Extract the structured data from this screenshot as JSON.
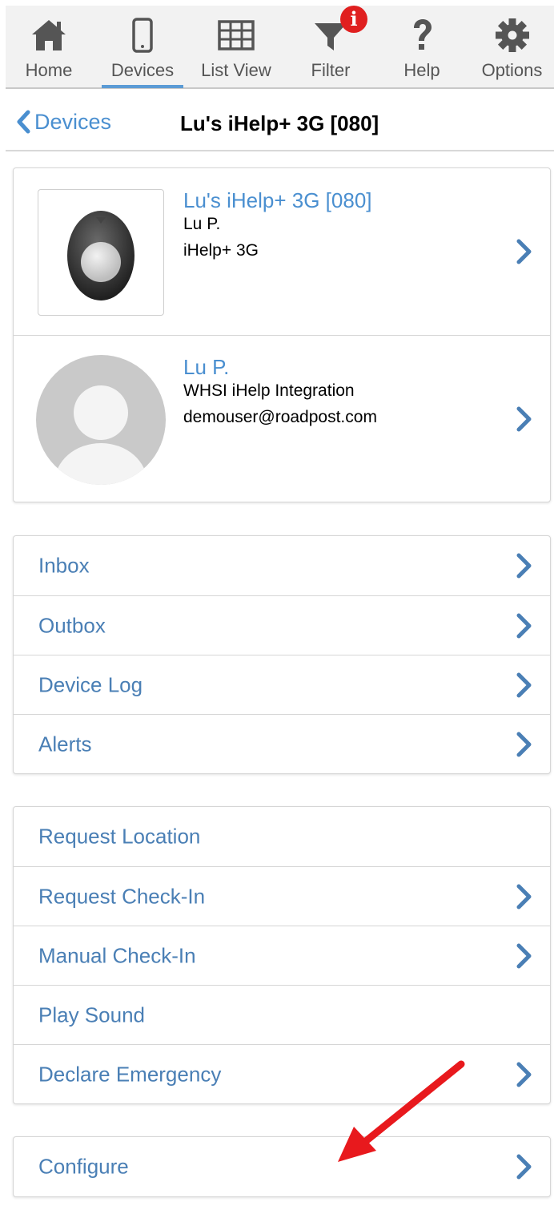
{
  "toolbar": {
    "items": [
      {
        "label": "Home",
        "icon": "home-icon"
      },
      {
        "label": "Devices",
        "icon": "smartphone-icon",
        "active": true
      },
      {
        "label": "List View",
        "icon": "grid-icon"
      },
      {
        "label": "Filter",
        "icon": "filter-icon",
        "badge": "i"
      },
      {
        "label": "Help",
        "icon": "question-icon"
      },
      {
        "label": "Options",
        "icon": "gear-icon"
      }
    ]
  },
  "header": {
    "back_label": "Devices",
    "title": "Lu's iHelp+ 3G [080]"
  },
  "device": {
    "name": "Lu's iHelp+ 3G [080]",
    "owner": "Lu P.",
    "model": "iHelp+ 3G"
  },
  "user": {
    "name": "Lu P.",
    "organization": "WHSI iHelp Integration",
    "email": "demouser@roadpost.com"
  },
  "messages_menu": [
    {
      "label": "Inbox",
      "chevron": true
    },
    {
      "label": "Outbox",
      "chevron": true
    },
    {
      "label": "Device Log",
      "chevron": true
    },
    {
      "label": "Alerts",
      "chevron": true
    }
  ],
  "actions_menu": [
    {
      "label": "Request Location",
      "chevron": false
    },
    {
      "label": "Request Check-In",
      "chevron": true
    },
    {
      "label": "Manual Check-In",
      "chevron": true
    },
    {
      "label": "Play Sound",
      "chevron": false
    },
    {
      "label": "Declare Emergency",
      "chevron": true
    }
  ],
  "config_menu": [
    {
      "label": "Configure",
      "chevron": true
    }
  ],
  "colors": {
    "accent": "#4a8fd0",
    "link_text": "#4a7fb5",
    "active_underline": "#5b9bd5",
    "badge": "#e02020",
    "annotation_arrow": "#e8191d",
    "icon": "#555555"
  }
}
